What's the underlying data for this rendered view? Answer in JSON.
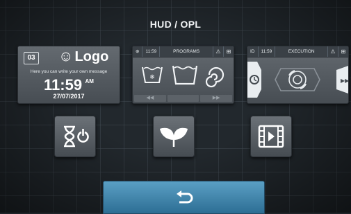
{
  "header": {
    "title": "HUD / OPL"
  },
  "logo_card": {
    "badge": "03",
    "logo_symbol": "☺",
    "logo_text": "Logo",
    "message": "Here you can write your own message",
    "time": "11:59",
    "ampm": "AM",
    "date": "27/07/2017"
  },
  "programs_card": {
    "id_label": "⊕",
    "time": "11:59",
    "title": "PROGRAMS",
    "icons": [
      "snowflake-wash-icon",
      "wash-tub-icon",
      "spiral-program-icon"
    ]
  },
  "execution_card": {
    "id_label": "ID",
    "time": "11:59",
    "title": "EXECUTION",
    "icons": [
      "drum-rotation-icon",
      "arrows-nav-icon"
    ]
  },
  "buttons": {
    "timer": "hourglass-power-icon",
    "eco": "eco-leaves-icon",
    "video": "video-film-icon",
    "back": "back-arrow-icon"
  },
  "colors": {
    "background": "#22282d",
    "card": "#555b61",
    "back_button": "#3b86b0"
  }
}
